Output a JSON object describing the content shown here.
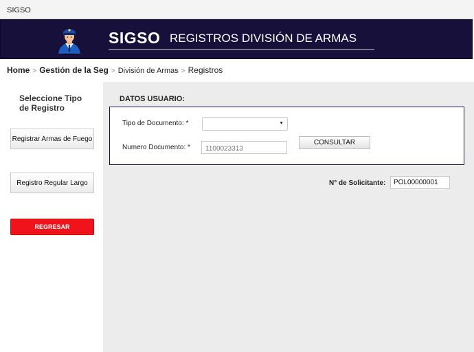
{
  "window": {
    "title": "SIGSO"
  },
  "header": {
    "brand": "SIGSO",
    "subtitle": "REGISTROS DIVISIÓN DE ARMAS",
    "avatar_icon": "police-officer-icon",
    "background_color": "#16103a"
  },
  "breadcrumb": {
    "items": [
      "Home",
      "Gestión de la Seg",
      "División de Armas",
      "Registros"
    ],
    "separator": ">"
  },
  "sidebar": {
    "title": "Seleccione Tipo de Registro",
    "buttons": [
      "Registrar Armas de Fuego",
      "Registro Regular Largo"
    ],
    "back_button": "REGRESAR",
    "back_button_color": "#f1131c"
  },
  "form": {
    "section_title": "DATOS USUARIO:",
    "tipo_documento_label": "Tipo de Documento: *",
    "tipo_documento_value": "",
    "numero_documento_label": "Numero Documento: *",
    "numero_documento_placeholder": "1100023313",
    "consultar_button": "CONSULTAR"
  },
  "solicitante": {
    "label": "N° de Solicitante:",
    "value": "POL00000001"
  }
}
